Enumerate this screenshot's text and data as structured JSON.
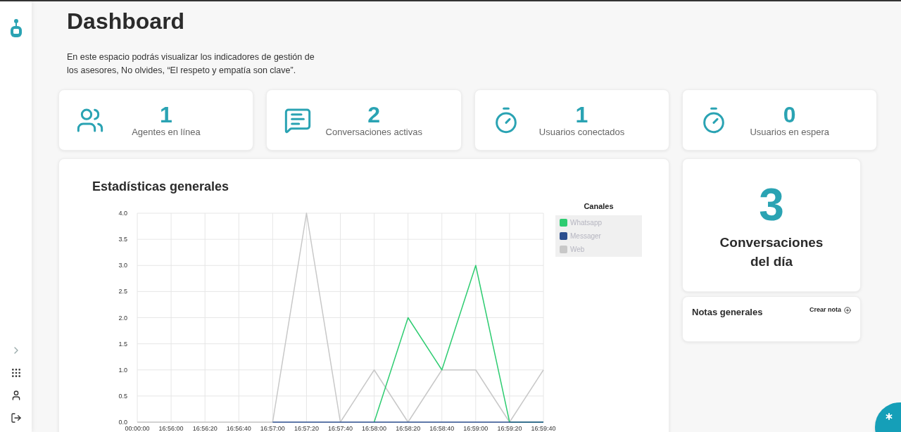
{
  "sidebar": {
    "items": [
      {
        "kind": "expand"
      },
      {
        "kind": "apps"
      },
      {
        "kind": "user"
      },
      {
        "kind": "logout"
      }
    ]
  },
  "header": {
    "title": "Dashboard",
    "description": "En este espacio podrás visualizar los indicadores de gestión de los asesores, No olvides, “El respeto y empatía son clave”."
  },
  "stats": [
    {
      "kind": "users",
      "value": "1",
      "label": "Agentes en línea"
    },
    {
      "kind": "chat",
      "value": "2",
      "label": "Conversaciones activas"
    },
    {
      "kind": "timer",
      "value": "1",
      "label": "Usuarios conectados"
    },
    {
      "kind": "timer",
      "value": "0",
      "label": "Usuarios en espera"
    }
  ],
  "chart_card": {
    "title": "Estadísticas generales",
    "legend_title": "Canales",
    "chart_data": {
      "type": "line",
      "categories": [
        "00:00:00",
        "16:56:00",
        "16:56:20",
        "16:56:40",
        "16:57:00",
        "16:57:20",
        "16:57:40",
        "16:58:00",
        "16:58:20",
        "16:58:40",
        "16:59:00",
        "16:59:20",
        "16:59:40"
      ],
      "ylim": [
        0,
        4
      ],
      "grid": true,
      "yticks": [
        {
          "value": 0,
          "label": "0.0"
        },
        {
          "value": 0.5,
          "label": "0.5"
        },
        {
          "value": 1,
          "label": "1.0"
        },
        {
          "value": 1.5,
          "label": "1.5"
        },
        {
          "value": 2,
          "label": "2.0"
        },
        {
          "value": 2.5,
          "label": "2.5"
        },
        {
          "value": 3,
          "label": "3.0"
        },
        {
          "value": 3.5,
          "label": "3.5"
        },
        {
          "value": 4,
          "label": "4.0"
        }
      ],
      "series": [
        {
          "name": "Whatsapp",
          "color": "#2ecc71",
          "values": [
            null,
            null,
            null,
            null,
            null,
            null,
            null,
            0,
            2,
            1,
            3,
            0,
            0
          ]
        },
        {
          "name": "Messager",
          "color": "#2c4f8f",
          "values": [
            null,
            null,
            null,
            null,
            0,
            0,
            0,
            0,
            0,
            0,
            0,
            0,
            0
          ]
        },
        {
          "name": "Web",
          "color": "#c8c8c8",
          "values": [
            0,
            0,
            0,
            0,
            0,
            4,
            0,
            1,
            0,
            1,
            1,
            0,
            1
          ]
        }
      ]
    }
  },
  "daily": {
    "value": "3",
    "label": "Conversaciones del día"
  },
  "notes": {
    "title": "Notas generales",
    "action": "Crear nota"
  }
}
